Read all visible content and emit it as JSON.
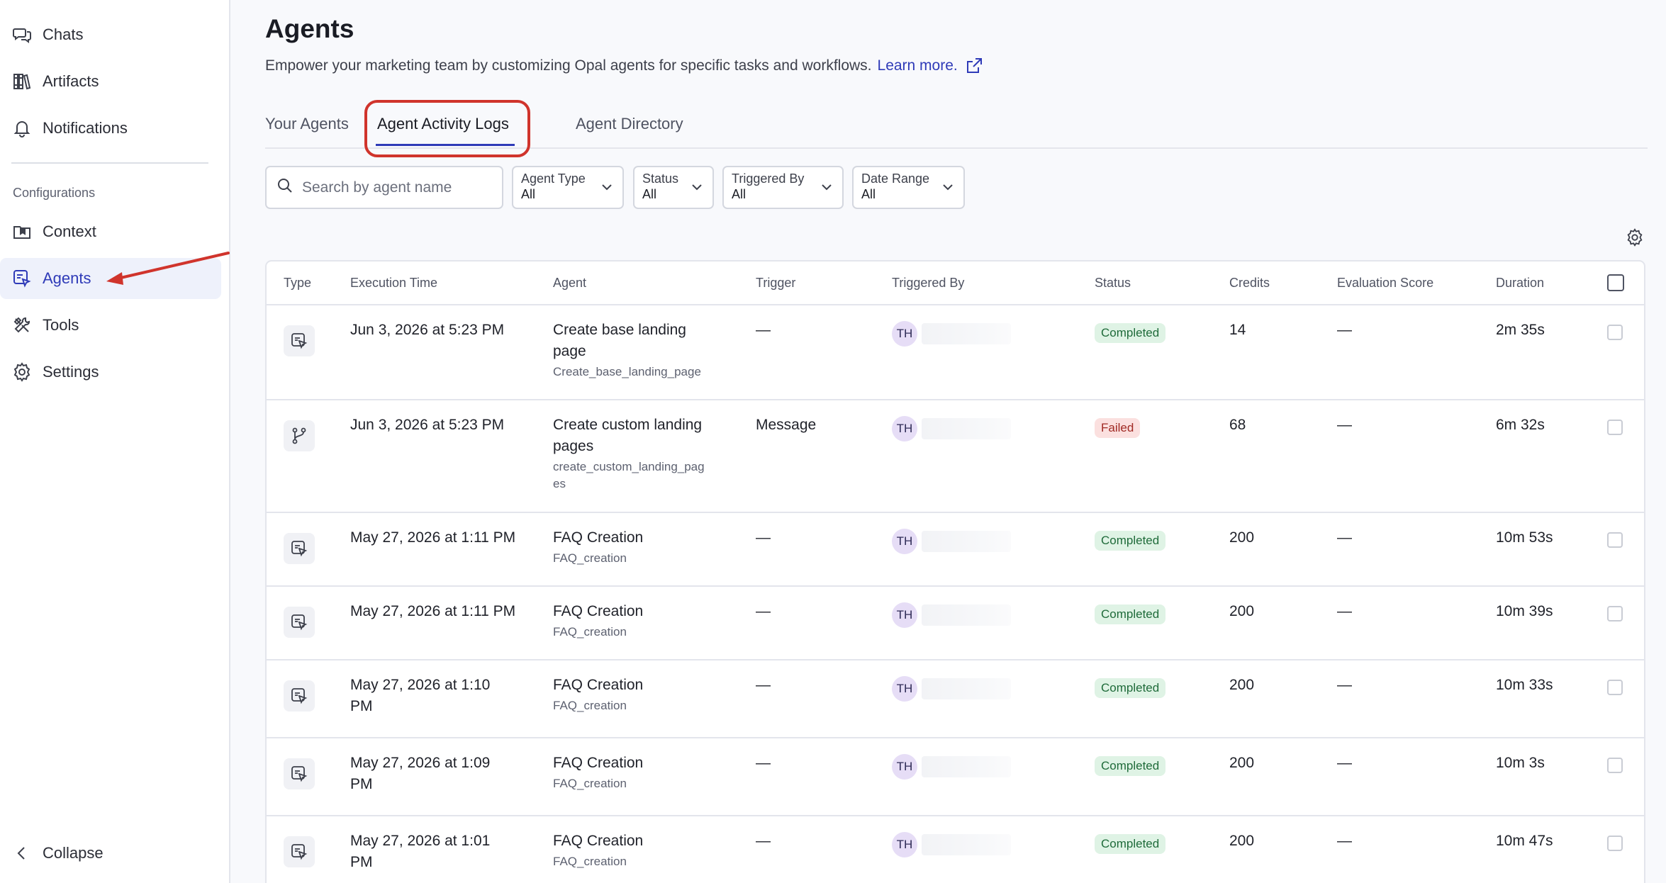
{
  "sidebar": {
    "items": [
      {
        "label": "Chats",
        "icon": "chat-icon"
      },
      {
        "label": "Artifacts",
        "icon": "library-icon"
      },
      {
        "label": "Notifications",
        "icon": "bell-icon"
      }
    ],
    "section_label": "Configurations",
    "config_items": [
      {
        "label": "Context",
        "icon": "folder-icon"
      },
      {
        "label": "Agents",
        "icon": "agent-icon",
        "active": true
      },
      {
        "label": "Tools",
        "icon": "tools-icon"
      },
      {
        "label": "Settings",
        "icon": "gear-icon"
      }
    ],
    "collapse_label": "Collapse"
  },
  "header": {
    "title": "Agents",
    "subtitle": "Empower your marketing team by customizing Opal agents for specific tasks and workflows.",
    "learn_more": "Learn more."
  },
  "tabs": [
    {
      "label": "Your Agents"
    },
    {
      "label": "Agent Activity Logs",
      "active": true
    },
    {
      "label": "Agent Directory"
    }
  ],
  "search": {
    "placeholder": "Search by agent name",
    "value": ""
  },
  "filters": [
    {
      "label": "Agent Type",
      "value": "All"
    },
    {
      "label": "Status",
      "value": "All"
    },
    {
      "label": "Triggered By",
      "value": "All"
    },
    {
      "label": "Date Range",
      "value": "All"
    }
  ],
  "table": {
    "columns": [
      "Type",
      "Execution Time",
      "Agent",
      "Trigger",
      "Triggered By",
      "Status",
      "Credits",
      "Evaluation Score",
      "Duration"
    ],
    "rows": [
      {
        "type": "specialized",
        "time_lines": [
          "Jun 3, 2026 at 5:23 PM"
        ],
        "agent_lines": [
          "Create base landing",
          "page"
        ],
        "agent_id_lines": [
          "Create_base_landing_page"
        ],
        "trigger": "—",
        "initials": "TH",
        "status": "Completed",
        "credits": "14",
        "score": "—",
        "duration": "2m 35s"
      },
      {
        "type": "workflow",
        "time_lines": [
          "Jun 3, 2026 at 5:23 PM"
        ],
        "agent_lines": [
          "Create custom landing",
          "pages"
        ],
        "agent_id_lines": [
          "create_custom_landing_pag",
          "es"
        ],
        "trigger": "Message",
        "initials": "TH",
        "status": "Failed",
        "credits": "68",
        "score": "—",
        "duration": "6m 32s"
      },
      {
        "type": "specialized",
        "time_lines": [
          "May 27, 2026 at 1:11 PM"
        ],
        "agent_lines": [
          "FAQ Creation"
        ],
        "agent_id_lines": [
          "FAQ_creation"
        ],
        "trigger": "—",
        "initials": "TH",
        "status": "Completed",
        "credits": "200",
        "score": "—",
        "duration": "10m 53s"
      },
      {
        "type": "specialized",
        "time_lines": [
          "May 27, 2026 at 1:11 PM"
        ],
        "agent_lines": [
          "FAQ Creation"
        ],
        "agent_id_lines": [
          "FAQ_creation"
        ],
        "trigger": "—",
        "initials": "TH",
        "status": "Completed",
        "credits": "200",
        "score": "—",
        "duration": "10m 39s"
      },
      {
        "type": "specialized",
        "time_lines": [
          "May 27, 2026 at 1:10",
          "PM"
        ],
        "agent_lines": [
          "FAQ Creation"
        ],
        "agent_id_lines": [
          "FAQ_creation"
        ],
        "trigger": "—",
        "initials": "TH",
        "status": "Completed",
        "credits": "200",
        "score": "—",
        "duration": "10m 33s"
      },
      {
        "type": "specialized",
        "time_lines": [
          "May 27, 2026 at 1:09",
          "PM"
        ],
        "agent_lines": [
          "FAQ Creation"
        ],
        "agent_id_lines": [
          "FAQ_creation"
        ],
        "trigger": "—",
        "initials": "TH",
        "status": "Completed",
        "credits": "200",
        "score": "—",
        "duration": "10m 3s"
      },
      {
        "type": "specialized",
        "time_lines": [
          "May 27, 2026 at 1:01",
          "PM"
        ],
        "agent_lines": [
          "FAQ Creation"
        ],
        "agent_id_lines": [
          "FAQ_creation"
        ],
        "trigger": "—",
        "initials": "TH",
        "status": "Completed",
        "credits": "200",
        "score": "—",
        "duration": "10m 47s"
      }
    ]
  },
  "colors": {
    "accent": "#2f3bb8",
    "annotation": "#d0342c",
    "completed_bg": "#dff3e5",
    "failed_bg": "#fbe0df"
  }
}
